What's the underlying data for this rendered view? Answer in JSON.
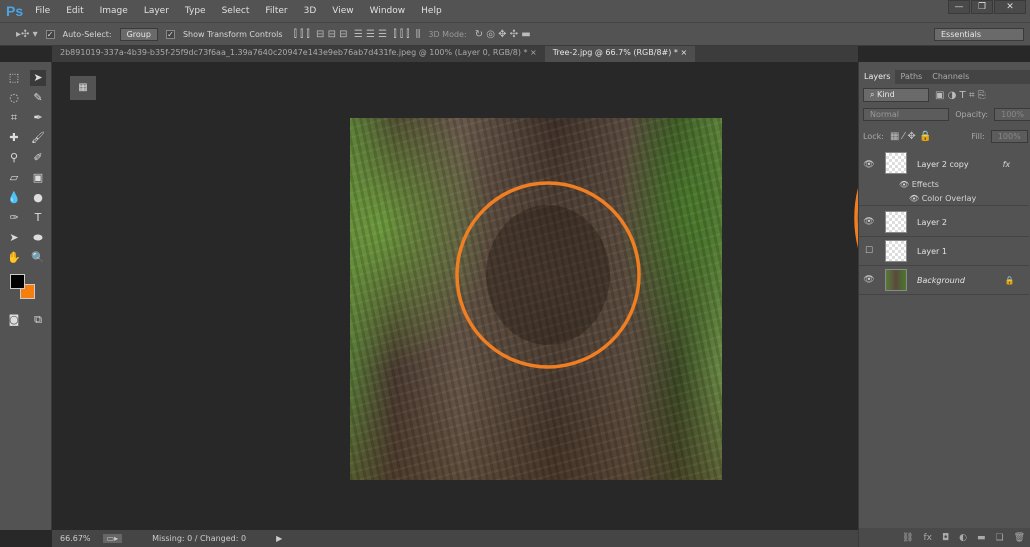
{
  "app": {
    "logo": "Ps",
    "menus": [
      "File",
      "Edit",
      "Image",
      "Layer",
      "Type",
      "Select",
      "Filter",
      "3D",
      "View",
      "Window",
      "Help"
    ],
    "window_buttons": [
      "—",
      "❐",
      "✕"
    ]
  },
  "options": {
    "auto_select": "Auto-Select:",
    "auto_select_value": "Group",
    "show_transform": "Show Transform Controls",
    "mode_3d": "3D Mode:",
    "workspace": "Essentials"
  },
  "tabs": [
    {
      "label": "2b891019-337a-4b39-b35f-25f9dc73f6aa_1.39a7640c20947e143e9eb76ab7d431fe.jpeg @ 100% (Layer 0, RGB/8) *",
      "active": false
    },
    {
      "label": "Tree-2.jpg @ 66.7% (RGB/8#) *",
      "active": true
    }
  ],
  "colors": {
    "foreground": "#000000",
    "background": "#f57f0e",
    "annotation": "#f07e22"
  },
  "status": {
    "zoom": "66.67%",
    "info": "Missing: 0 / Changed: 0"
  },
  "layers_panel": {
    "tabs": [
      "Layers",
      "Paths",
      "Channels"
    ],
    "filter": "Kind",
    "blend": "Normal",
    "opacity_label": "Opacity:",
    "opacity": "100%",
    "lock_label": "Lock:",
    "fill_label": "Fill:",
    "fill": "100%",
    "layers": [
      {
        "name": "Layer 2 copy",
        "visible": true,
        "fx": "fx"
      },
      {
        "name": "Layer 2",
        "visible": true
      },
      {
        "name": "Layer 1",
        "visible": false
      },
      {
        "name": "Background",
        "visible": true,
        "locked": true
      }
    ],
    "effects_label": "Effects",
    "effect": "Color Overlay"
  }
}
